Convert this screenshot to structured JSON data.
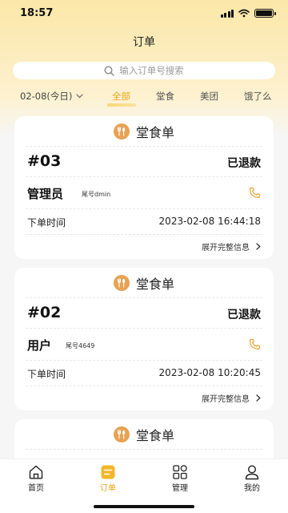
{
  "status_bar": {
    "time": "18:57"
  },
  "header": {
    "title": "订单"
  },
  "search": {
    "placeholder": "输入订单号搜索"
  },
  "filters": {
    "date": "02-08(今日)",
    "tabs": [
      "全部",
      "堂食",
      "美团",
      "饿了么"
    ],
    "active_tab": "全部"
  },
  "orders": [
    {
      "type": "堂食单",
      "number": "#03",
      "status": "已退款",
      "customer": "管理员",
      "tail": "尾号dmin",
      "time_label": "下单时间",
      "time": "2023-02-08 16:44:18",
      "expand": "展开完整信息"
    },
    {
      "type": "堂食单",
      "number": "#02",
      "status": "已退款",
      "customer": "用户",
      "tail": "尾号4649",
      "time_label": "下单时间",
      "time": "2023-02-08 10:20:45",
      "expand": "展开完整信息"
    },
    {
      "type": "堂食单"
    }
  ],
  "tabbar": [
    {
      "label": "首页",
      "icon": "home-icon"
    },
    {
      "label": "订单",
      "icon": "order-icon"
    },
    {
      "label": "管理",
      "icon": "manage-grid-icon"
    },
    {
      "label": "我的",
      "icon": "user-icon"
    }
  ],
  "colors": {
    "accent": "#e9a416",
    "food_icon": "#e7a254",
    "phone_icon": "#e0a436"
  }
}
